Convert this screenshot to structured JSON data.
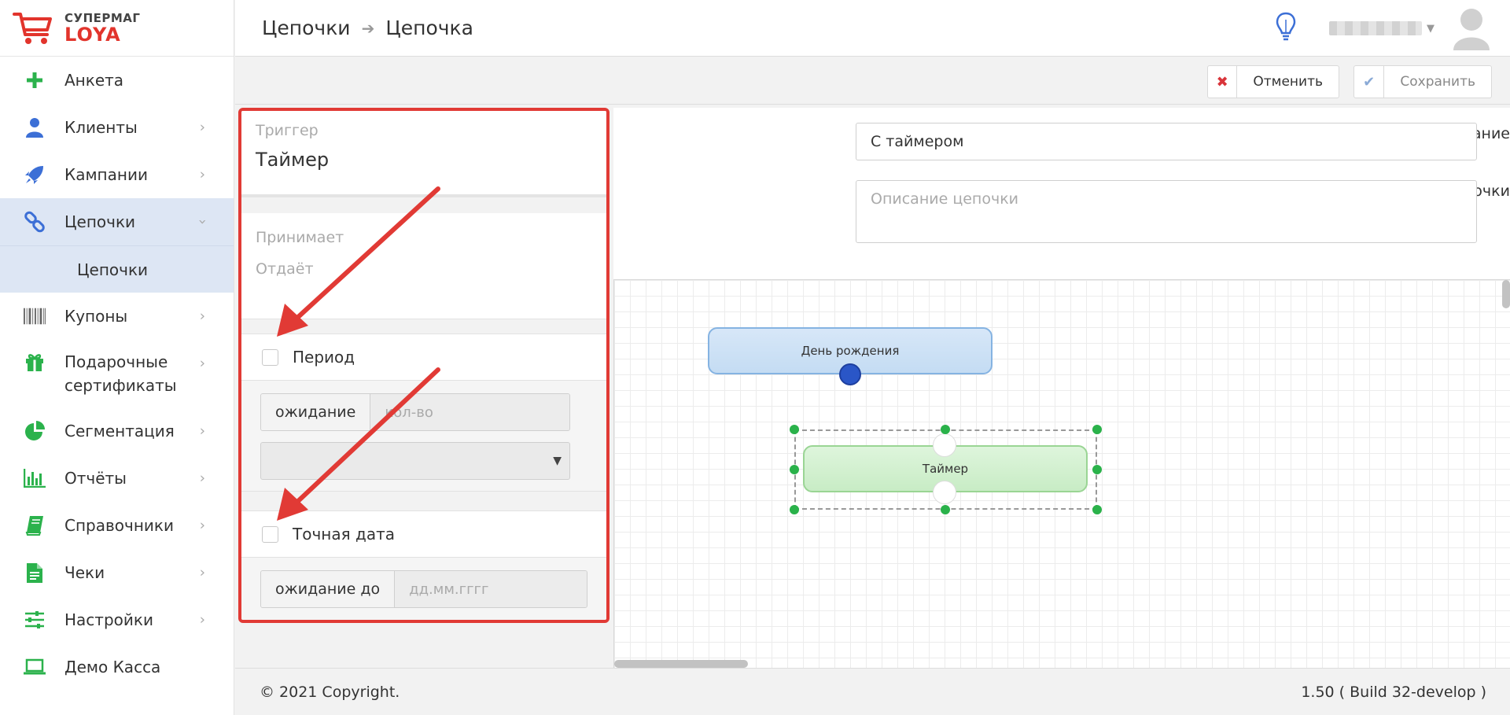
{
  "brand": {
    "top": "СУПЕРМАГ",
    "bottom": "LOYA",
    "accent": "#e2342c"
  },
  "sidebar": {
    "items": [
      {
        "label": "Анкета",
        "icon": "plus-icon",
        "chevron": false
      },
      {
        "label": "Клиенты",
        "icon": "user-icon",
        "chevron": true
      },
      {
        "label": "Кампании",
        "icon": "rocket-icon",
        "chevron": true
      },
      {
        "label": "Цепочки",
        "icon": "chain-icon",
        "chevron": true,
        "active": true
      },
      {
        "label": "Купоны",
        "icon": "barcode-icon",
        "chevron": true
      },
      {
        "label": "Подарочные сертификаты",
        "icon": "gift-icon",
        "chevron": true
      },
      {
        "label": "Сегментация",
        "icon": "pie-chart-icon",
        "chevron": true
      },
      {
        "label": "Отчёты",
        "icon": "bar-chart-icon",
        "chevron": true
      },
      {
        "label": "Справочники",
        "icon": "book-icon",
        "chevron": true
      },
      {
        "label": "Чеки",
        "icon": "receipt-icon",
        "chevron": true
      },
      {
        "label": "Настройки",
        "icon": "sliders-icon",
        "chevron": true
      },
      {
        "label": "Демо Касса",
        "icon": "laptop-icon",
        "chevron": false
      }
    ],
    "submenu": {
      "label": "Цепочки"
    }
  },
  "header": {
    "breadcrumb": [
      "Цепочки",
      "Цепочка"
    ],
    "separator": "➔"
  },
  "toolbar": {
    "cancel_label": "Отменить",
    "save_label": "Сохранить"
  },
  "panel": {
    "trigger_label": "Триггер",
    "trigger_name": "Таймер",
    "accepts_label": "Принимает",
    "gives_label": "Отдаёт",
    "period_label": "Период",
    "wait_label": "ожидание",
    "wait_placeholder": "кол-во",
    "exact_date_label": "Точная дата",
    "wait_until_label": "ожидание до",
    "date_placeholder": "дд.мм.гггг"
  },
  "form": {
    "name_label": "Название",
    "name_value": "С таймером",
    "desc_label": "Описание цепочки",
    "desc_placeholder": "Описание цепочки"
  },
  "canvas": {
    "node_birthday": "День рождения",
    "node_timer": "Таймер"
  },
  "footer": {
    "copyright": "© 2021 Copyright.",
    "version": "1.50 ( Build 32-develop )"
  }
}
